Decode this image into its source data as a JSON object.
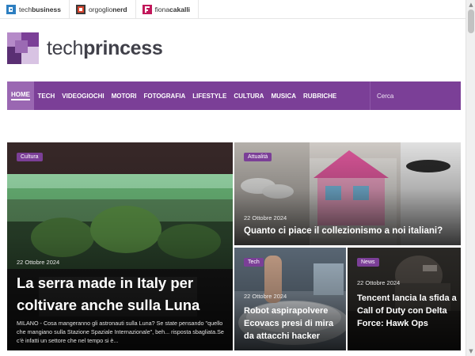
{
  "network": {
    "items": [
      {
        "pre": "tech",
        "bold": "business",
        "color": "#2d7fc1"
      },
      {
        "pre": "orgoglio",
        "bold": "nerd",
        "color": "#d9452e"
      },
      {
        "pre": "fiona",
        "bold": "cakalli",
        "color": "#c2185b"
      }
    ]
  },
  "brand": {
    "part1": "tech",
    "part2": "princess",
    "accent": "#7b3f97"
  },
  "nav": {
    "items": [
      "HOME",
      "TECH",
      "VIDEOGIOCHI",
      "MOTORI",
      "FOTOGRAFIA",
      "LIFESTYLE",
      "CULTURA",
      "MUSICA",
      "RUBRICHE"
    ],
    "active": "HOME",
    "search_placeholder": "Cerca"
  },
  "articles": {
    "featured": {
      "category": "Cultura",
      "date": "22 Ottobre 2024",
      "title": "La serra made in Italy per coltivare anche sulla Luna",
      "excerpt": "MILANO - Cosa mangeranno gli astronauti sulla Luna? Se state pensando \"quello che mangiano sulla Stazione Spaziale Internazionale\", beh... risposta sbagliata.Se c'è infatti un settore che nel tempo si è..."
    },
    "top_right": {
      "category": "Attualità",
      "date": "22 Ottobre 2024",
      "title": "Quanto ci piace il collezionismo a noi italiani?"
    },
    "bottom_left": {
      "category": "Tech",
      "date": "22 Ottobre 2024",
      "title": "Robot aspirapolvere Ecovacs presi di mira da attacchi hacker"
    },
    "bottom_right": {
      "category": "News",
      "date": "22 Ottobre 2024",
      "title": "Tencent lancia la sfida a Call of Duty con Delta Force: Hawk Ops"
    }
  },
  "colors": {
    "nav_bg": "#7b3f97",
    "nav_active": "#9a67b2",
    "category_bg": "#7b3f97"
  }
}
